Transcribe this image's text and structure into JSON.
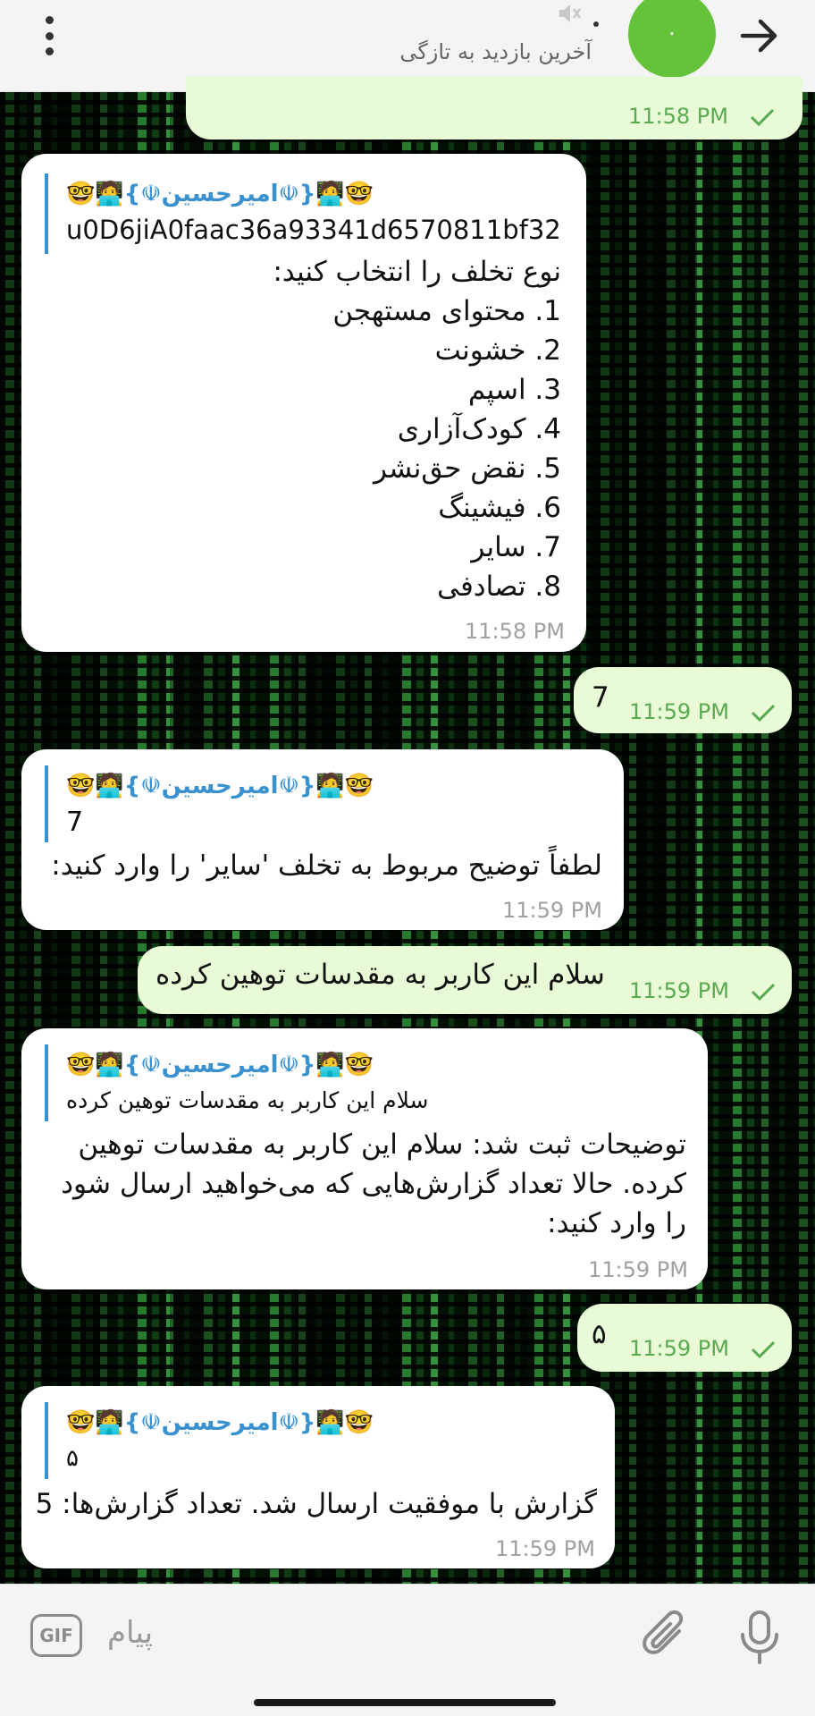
{
  "header": {
    "status": "آخرین بازدید به تازگی",
    "avatar_letter": "·",
    "menu_icon": "more-vert-icon",
    "mute_icon": "muted-icon",
    "back_icon": "arrow-forward-icon"
  },
  "messages": {
    "m0": {
      "time": "11:58 PM"
    },
    "m1": {
      "reply_name": "🤓🧑‍💻{☫امیرحسین☫}🧑‍💻🤓",
      "reply_text": "u0D6jiA0faac36a93341d6570811bf32",
      "lines": [
        "نوع تخلف را انتخاب کنید:",
        "1. محتوای مستهجن",
        "2. خشونت",
        "3. اسپم",
        "4. کودک‌آزاری",
        "5. نقض حق‌نشر",
        "6. فیشینگ",
        "7. سایر",
        "8. تصادفی"
      ],
      "time": "11:58 PM"
    },
    "m2": {
      "text": "7",
      "time": "11:59 PM"
    },
    "m3": {
      "reply_name": "🤓🧑‍💻{☫امیرحسین☫}🧑‍💻🤓",
      "reply_text": "7",
      "text": "لطفاً توضیح مربوط به تخلف 'سایر' را وارد کنید:",
      "time": "11:59 PM"
    },
    "m4": {
      "text": "سلام این کاربر به مقدسات توهین کرده",
      "time": "11:59 PM"
    },
    "m5": {
      "reply_name": "🤓🧑‍💻{☫امیرحسین☫}🧑‍💻🤓",
      "reply_text": "سلام این کاربر به مقدسات توهین کرده",
      "lines": [
        "توضیحات ثبت شد: سلام این کاربر به مقدسات توهین",
        "کرده. حالا تعداد گزارش‌هایی که می‌خواهید ارسال شود",
        "را وارد کنید:"
      ],
      "time": "11:59 PM"
    },
    "m6": {
      "text": "۵",
      "time": "11:59 PM"
    },
    "m7": {
      "reply_name": "🤓🧑‍💻{☫امیرحسین☫}🧑‍💻🤓",
      "reply_text": "۵",
      "text": "گزارش با موفقیت ارسال شد. تعداد گزارش‌ها: 5",
      "time": "11:59 PM"
    }
  },
  "input": {
    "gif_label": "GIF",
    "placeholder": "پیام",
    "attach_icon": "paperclip-icon",
    "mic_icon": "microphone-icon"
  },
  "colors": {
    "accent": "#3a91d0",
    "outgoing": "#e8fbd6",
    "avatar": "#64c33a",
    "check": "#5aaa52"
  }
}
